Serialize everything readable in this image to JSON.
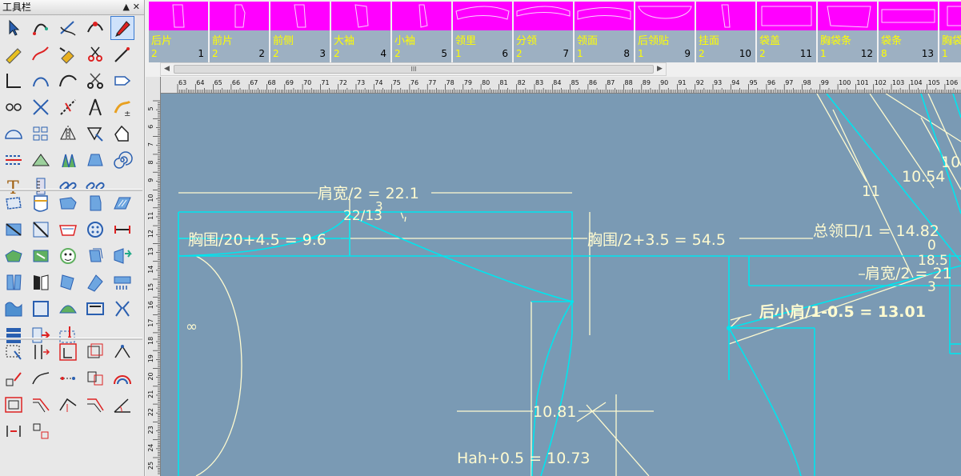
{
  "toolbox": {
    "title": "工具栏",
    "pin_icon": "pin-icon",
    "close_icon": "close-icon"
  },
  "pieces": [
    {
      "name": "后片",
      "count": "2",
      "index": "1"
    },
    {
      "name": "前片",
      "count": "2",
      "index": "2"
    },
    {
      "name": "前侧",
      "count": "2",
      "index": "3"
    },
    {
      "name": "大袖",
      "count": "2",
      "index": "4"
    },
    {
      "name": "小袖",
      "count": "2",
      "index": "5"
    },
    {
      "name": "领里",
      "count": "1",
      "index": "6"
    },
    {
      "name": "分领",
      "count": "2",
      "index": "7"
    },
    {
      "name": "领面",
      "count": "1",
      "index": "8"
    },
    {
      "name": "后领贴",
      "count": "1",
      "index": "9"
    },
    {
      "name": "挂面",
      "count": "2",
      "index": "10"
    },
    {
      "name": "袋盖",
      "count": "2",
      "index": "11"
    },
    {
      "name": "胸袋条",
      "count": "1",
      "index": "12"
    },
    {
      "name": "袋条",
      "count": "8",
      "index": "13"
    },
    {
      "name": "胸袋",
      "count": "1",
      "index": ""
    }
  ],
  "scrollbar": {
    "thumb_grip": "III"
  },
  "ruler": {
    "h_labels": [
      "63",
      "64",
      "65",
      "66",
      "67",
      "68",
      "69",
      "70",
      "71",
      "72",
      "73",
      "74",
      "75",
      "76",
      "77",
      "78",
      "79",
      "80",
      "81",
      "82",
      "83",
      "84",
      "85",
      "86",
      "87",
      "88",
      "89",
      "90",
      "91",
      "92",
      "93",
      "94",
      "95",
      "96",
      "97",
      "98",
      "99",
      "100",
      "101",
      "102",
      "103",
      "104",
      "105",
      "106"
    ],
    "v_labels": [
      "5",
      "6",
      "7",
      "8",
      "9",
      "10",
      "11",
      "12",
      "13",
      "14",
      "15",
      "16",
      "17",
      "18",
      "19",
      "20",
      "21",
      "22",
      "23",
      "24",
      "25"
    ]
  },
  "canvas": {
    "labels": {
      "shoulder_half": "肩宽/2 = 22.1",
      "shoulder_slope": "22/13",
      "small_3": "3",
      "bust_20": "胸围/20+4.5 = 9.6",
      "bust_half": "胸围/2+3.5 = 54.5",
      "neck_total": "总领口/1 = 14.82",
      "shoulder_half_right": "肩宽/2 = 21",
      "back_shoulder": "后小肩/1-0.5 = 13.01",
      "val_18_5": "18.5",
      "val_0": "0",
      "val_3": "3",
      "val_11": "11",
      "val_10_54": "10.54",
      "val_10": "10",
      "val_10_81": "10.81",
      "hah": "Hah+0.5 = 10.73",
      "infinity": "∞"
    },
    "colors": {
      "background": "#7a9ab4",
      "cyan": "#00e5ee",
      "cream": "#fffbd0"
    }
  }
}
